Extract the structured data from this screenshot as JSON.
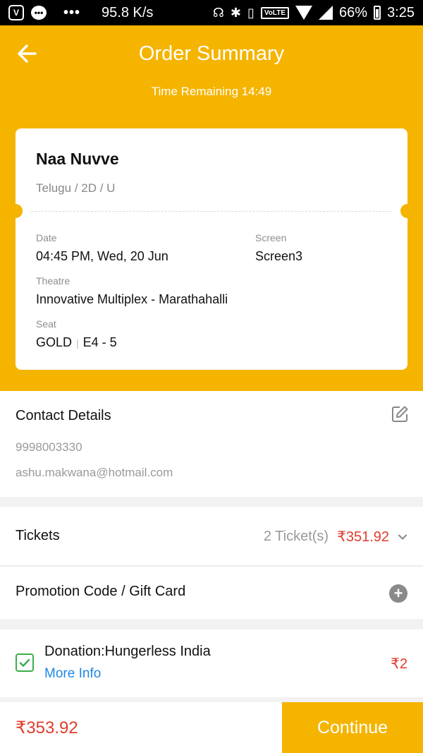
{
  "status_bar": {
    "speed": "95.8 K/s",
    "volte": "VoLTE",
    "battery": "66%",
    "time": "3:25"
  },
  "header": {
    "title": "Order Summary",
    "timer_label": "Time Remaining",
    "timer_value": "14:49"
  },
  "ticket": {
    "movie": "Naa Nuvve",
    "meta": "Telugu / 2D / U",
    "date_label": "Date",
    "date_value": "04:45 PM, Wed, 20 Jun",
    "screen_label": "Screen",
    "screen_value": "Screen3",
    "theatre_label": "Theatre",
    "theatre_value": "Innovative Multiplex - Marathahalli",
    "seat_label": "Seat",
    "seat_class": "GOLD",
    "seat_numbers": "E4 - 5"
  },
  "contact": {
    "title": "Contact Details",
    "phone": "9998003330",
    "email": "ashu.makwana@hotmail.com"
  },
  "tickets": {
    "title": "Tickets",
    "count": "2 Ticket(s)",
    "price": "₹351.92"
  },
  "promo": {
    "title": "Promotion Code / Gift Card"
  },
  "donation": {
    "title": "Donation:Hungerless India",
    "more_info": "More Info",
    "price": "₹2",
    "checked": true
  },
  "footer": {
    "total": "₹353.92",
    "continue_label": "Continue"
  },
  "colors": {
    "brand_yellow": "#f5b400",
    "price_red": "#e03b2c",
    "link_blue": "#1e88e5",
    "check_green": "#3cae4c"
  }
}
